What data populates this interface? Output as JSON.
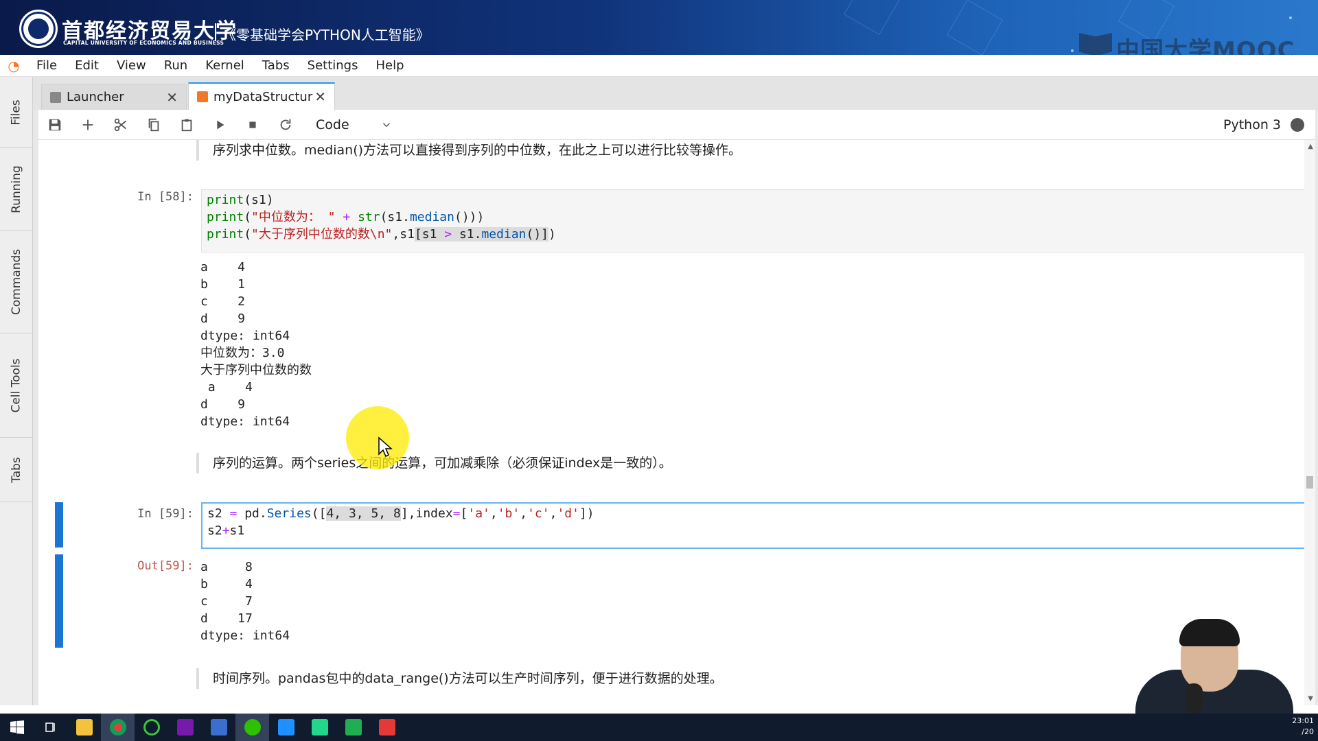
{
  "banner": {
    "university_cn": "首都经济贸易大学",
    "university_en": "CAPITAL UNIVERSITY OF ECONOMICS AND BUSINESS",
    "course_title": "《零基础学会PYTHON人工智能》",
    "platform": "中国大学MOOC"
  },
  "menu": [
    "File",
    "Edit",
    "View",
    "Run",
    "Kernel",
    "Tabs",
    "Settings",
    "Help"
  ],
  "sidebar": [
    "Files",
    "Running",
    "Commands",
    "Cell Tools",
    "Tabs"
  ],
  "tabs": [
    {
      "label": "Launcher",
      "close": "✕"
    },
    {
      "label": "myDataStructur",
      "close": "✕"
    }
  ],
  "toolbar": {
    "cell_type": "Code",
    "kernel": "Python 3"
  },
  "cells": {
    "md1": "序列求中位数。median()方法可以直接得到序列的中位数，在此之上可以进行比较等操作。",
    "c58_prompt": "In [58]:",
    "c58_out": "a    4\nb    1\nc    2\nd    9\ndtype: int64\n中位数为：3.0\n大于序列中位数的数\n a    4\nd    9\ndtype: int64",
    "md2": "序列的运算。两个series之间的运算，可加减乘除（必须保证index是一致的）。",
    "c59_prompt": "In [59]:",
    "c59_out_prompt": "Out[59]:",
    "c59_out": "a     8\nb     4\nc     7\nd    17\ndtype: int64",
    "md3": "时间序列。pandas包中的data_range()方法可以生产时间序列，便于进行数据的处理。"
  },
  "clock": {
    "time": "23:01",
    "date": "/20"
  },
  "colors": {
    "accent": "#1976d2",
    "active_tab_border": "#2196f3",
    "jupyter_orange": "#f37726"
  }
}
